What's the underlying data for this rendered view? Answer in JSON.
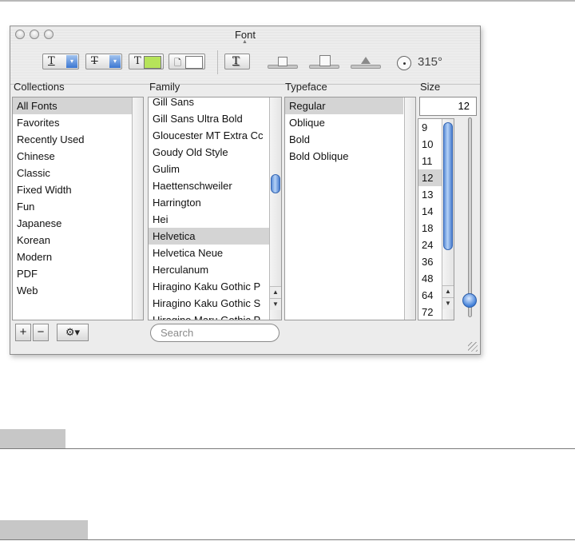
{
  "window": {
    "title": "Font"
  },
  "toolbar": {
    "angle": "315°"
  },
  "columns": {
    "collections": "Collections",
    "family": "Family",
    "typeface": "Typeface",
    "size": "Size"
  },
  "collections": [
    "All Fonts",
    "Favorites",
    "Recently Used",
    "Chinese",
    "Classic",
    "Fixed Width",
    "Fun",
    "Japanese",
    "Korean",
    "Modern",
    "PDF",
    "Web"
  ],
  "families": [
    "Gill Sans",
    "Gill Sans Ultra Bold",
    "Gloucester MT Extra Cc",
    "Goudy Old Style",
    "Gulim",
    "Haettenschweiler",
    "Harrington",
    "Hei",
    "Helvetica",
    "Helvetica Neue",
    "Herculanum",
    "Hiragino Kaku Gothic P",
    "Hiragino Kaku Gothic S",
    "Hiragino Maru Gothic P"
  ],
  "typefaces": [
    "Regular",
    "Oblique",
    "Bold",
    "Bold Oblique"
  ],
  "size": {
    "value": "12",
    "list": [
      "9",
      "10",
      "11",
      "12",
      "13",
      "14",
      "18",
      "24",
      "36",
      "48",
      "64",
      "72"
    ]
  },
  "search": {
    "placeholder": "Search"
  },
  "colors": {
    "accent": "#3b77d2",
    "selection": "#d4d4d4",
    "text_color_swatch": "#b6e35a"
  }
}
